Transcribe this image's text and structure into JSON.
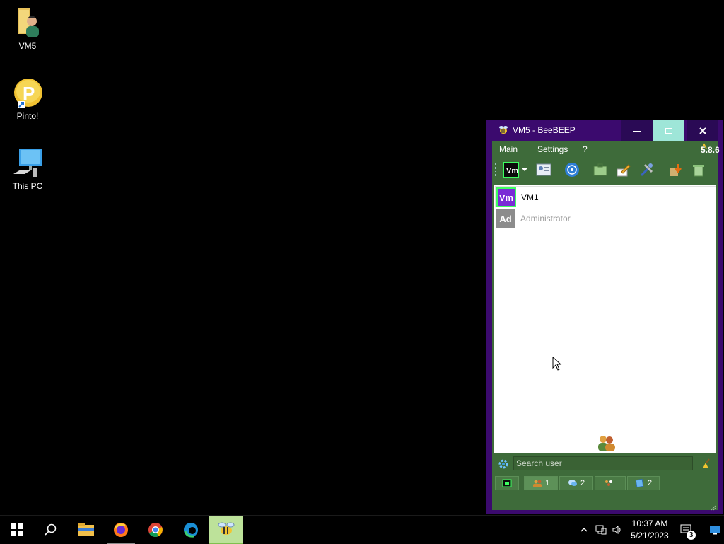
{
  "desktop": {
    "icons": [
      {
        "label": "VM5",
        "icon": "user-folder-icon"
      },
      {
        "label": "Pinto!",
        "icon": "pinto-shortcut-icon"
      },
      {
        "label": "This PC",
        "icon": "computer-icon"
      }
    ]
  },
  "window": {
    "title": "VM5 - BeeBEEP",
    "menu": {
      "main": "Main",
      "settings": "Settings",
      "help": "?"
    },
    "version": "5.8.6",
    "users": [
      {
        "initials": "Vm",
        "name": "VM1",
        "color": "#7a2bd6",
        "status": "online"
      },
      {
        "initials": "Ad",
        "name": "Administrator",
        "color": "#8c8c8c",
        "status": "offline"
      }
    ],
    "search": {
      "placeholder": "Search user"
    },
    "tabs": [
      {
        "icon": "users-icon",
        "count": "1"
      },
      {
        "icon": "chat-icon",
        "count": "2"
      },
      {
        "icon": "groups-icon",
        "count": ""
      },
      {
        "icon": "files-icon",
        "count": "2"
      }
    ]
  },
  "taskbar": {
    "time": "10:37 AM",
    "date": "5/21/2023",
    "notifications": "3"
  },
  "colors": {
    "window_border": "#3b0a6e",
    "client_bg": "#3e6b3a",
    "maximize_hover": "#9ee6d8",
    "active_task": "#bde29a"
  }
}
